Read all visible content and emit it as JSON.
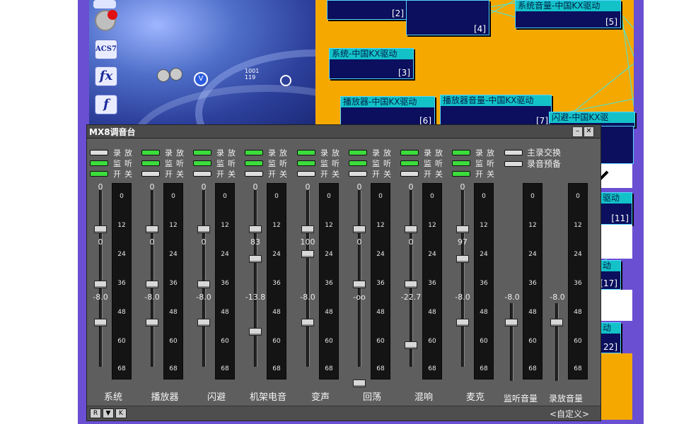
{
  "dsp_nodes": [
    {
      "caption": "",
      "index": "[2]"
    },
    {
      "caption": "",
      "index": "[4]"
    },
    {
      "caption": "系统音量-中国KX驱动",
      "index": "[5]"
    },
    {
      "caption": "系统-中国KX驱动",
      "index": "[3]"
    },
    {
      "caption": "播放器-中国KX驱动",
      "index": "[6]"
    },
    {
      "caption": "播放器音量-中国KX驱动",
      "index": "[7]"
    },
    {
      "caption": "闪避-中国KX驱",
      "index": ""
    },
    {
      "caption": "驱动",
      "index": "[11]"
    },
    {
      "caption": "动",
      "index": "[17]"
    },
    {
      "caption": "动",
      "index": "22]"
    }
  ],
  "desktop_icons": {
    "acs_label": "ACS7",
    "fx_label": "fx",
    "f_label": "f",
    "counter_label": "1001\n119"
  },
  "mixer": {
    "title": "MX8调音台",
    "toggle_labels": [
      [
        "录",
        "放"
      ],
      [
        "监",
        "听"
      ],
      [
        "开",
        "关"
      ]
    ],
    "master_labels": [
      "主录交换",
      "录音预备"
    ],
    "channels": [
      {
        "name": "系统",
        "top_value": "0",
        "mid_value": "0",
        "bottom_value": "-8.0",
        "switches": [
          "off",
          "on",
          "on"
        ]
      },
      {
        "name": "播放器",
        "top_value": "0",
        "mid_value": "0",
        "bottom_value": "-8.0",
        "switches": [
          "on",
          "on",
          "off"
        ]
      },
      {
        "name": "闪避",
        "top_value": "0",
        "mid_value": "0",
        "bottom_value": "-8.0",
        "switches": [
          "on",
          "on",
          "off"
        ]
      },
      {
        "name": "机架电音",
        "top_value": "0",
        "mid_value": "83",
        "bottom_value": "-13.8",
        "switches": [
          "on",
          "on",
          "off"
        ]
      },
      {
        "name": "变声",
        "top_value": "0",
        "mid_value": "100",
        "bottom_value": "-8.0",
        "switches": [
          "on",
          "on",
          "off"
        ]
      },
      {
        "name": "回荡",
        "top_value": "0",
        "mid_value": "0",
        "bottom_value": "-oo",
        "switches": [
          "on",
          "on",
          "off"
        ]
      },
      {
        "name": "混响",
        "top_value": "0",
        "mid_value": "0",
        "bottom_value": "-22.7",
        "switches": [
          "on",
          "on",
          "off"
        ]
      },
      {
        "name": "麦克",
        "top_value": "0",
        "mid_value": "97",
        "bottom_value": "-8.0",
        "switches": [
          "on",
          "on",
          "on"
        ]
      }
    ],
    "outputs": [
      {
        "name": "监听音量",
        "value": "-8.0"
      },
      {
        "name": "录放音量",
        "value": "-8.0"
      }
    ],
    "meter_ticks": [
      "0",
      "12",
      "24",
      "36",
      "48",
      "60",
      "68"
    ],
    "bottom_buttons": [
      "R",
      "▼",
      "K"
    ],
    "custom_label": "<自定义>"
  }
}
